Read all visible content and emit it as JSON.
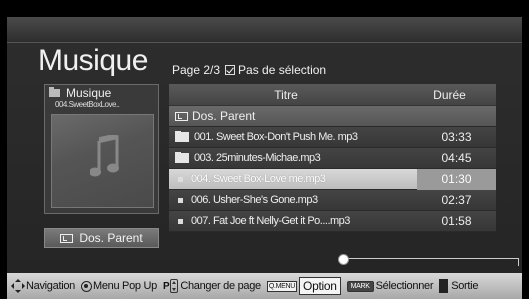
{
  "header": {
    "title": "Musique",
    "page_info": "Page 2/3",
    "selection_status": "Pas de sélection"
  },
  "left_panel": {
    "label": "Musique",
    "current_file": "004.SweetBoxLove..",
    "parent_button": "Dos. Parent"
  },
  "table": {
    "col_title": "Titre",
    "col_duration": "Durée",
    "rows": [
      {
        "type": "parent",
        "name": "Dos. Parent",
        "duration": ""
      },
      {
        "type": "folder",
        "name": "001. Sweet Box-Don't Push Me. mp3",
        "duration": "03:33"
      },
      {
        "type": "folder",
        "name": "003. 25minutes-Michae.mp3",
        "duration": "04:45"
      },
      {
        "type": "file",
        "name": "004. Sweet Box-Love me.mp3",
        "duration": "01:30",
        "selected": true
      },
      {
        "type": "file",
        "name": "006. Usher-She's Gone.mp3",
        "duration": "02:37"
      },
      {
        "type": "file",
        "name": "007. Fat Joe ft Nelly-Get it Po....mp3",
        "duration": "01:58"
      }
    ]
  },
  "bottom_bar": {
    "navigation": "Navigation",
    "menu_popup": "Menu Pop Up",
    "p_key": "P",
    "change_page": "Changer de page",
    "qmenu_key": "Q.MENU",
    "option": "Option",
    "mark_key": "MARK",
    "select": "Sélectionner",
    "exit": "Sortie"
  },
  "colors": {
    "background": "#242424",
    "selected_row": "#c8c8c8",
    "bottom_bar": "#c0c0c0"
  }
}
